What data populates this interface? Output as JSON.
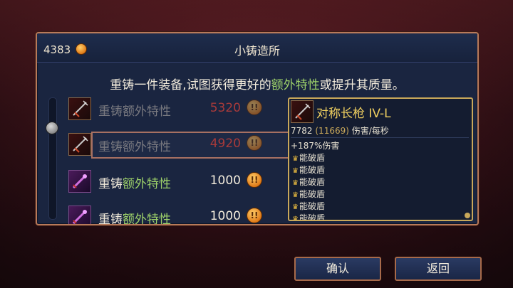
{
  "header": {
    "currency_amount": "4383",
    "title": "小铸造所"
  },
  "description": {
    "part1": "重铸一件装备,试图获得更好的",
    "highlight": "额外特性",
    "part2": "或提升其质量。"
  },
  "rows": [
    {
      "prefix": "重铸",
      "highlight": "额外特性",
      "price": "5320",
      "state": "dim"
    },
    {
      "prefix": "重铸",
      "highlight": "额外特性",
      "price": "4920",
      "state": "dim-selected"
    },
    {
      "prefix": "重铸",
      "highlight": "额外特性",
      "price": "1000",
      "state": "active"
    },
    {
      "prefix": "重铸",
      "highlight": "额外特性",
      "price": "1000",
      "state": "active"
    }
  ],
  "tooltip": {
    "item_name": "对称长枪 IV-L",
    "dps_value": "7782",
    "dps_max": "(11669)",
    "dps_unit": "伤害/每秒",
    "bonus": "+187%伤害",
    "perks": [
      "能破盾",
      "能破盾",
      "能破盾",
      "能破盾",
      "能破盾",
      "能破盾"
    ]
  },
  "buttons": {
    "confirm": "确认",
    "back": "返回"
  },
  "colors": {
    "highlight_green": "#9ed26a",
    "price_red": "#a83a3a",
    "item_name_gold": "#f0d060",
    "panel_bg": "#1a2540",
    "border": "#b87a5a"
  },
  "icons": {
    "currency": "cell-coin-icon",
    "row_item": "spear-icon",
    "row_item_alt": "purple-weapon-icon",
    "perk": "crown-icon"
  }
}
